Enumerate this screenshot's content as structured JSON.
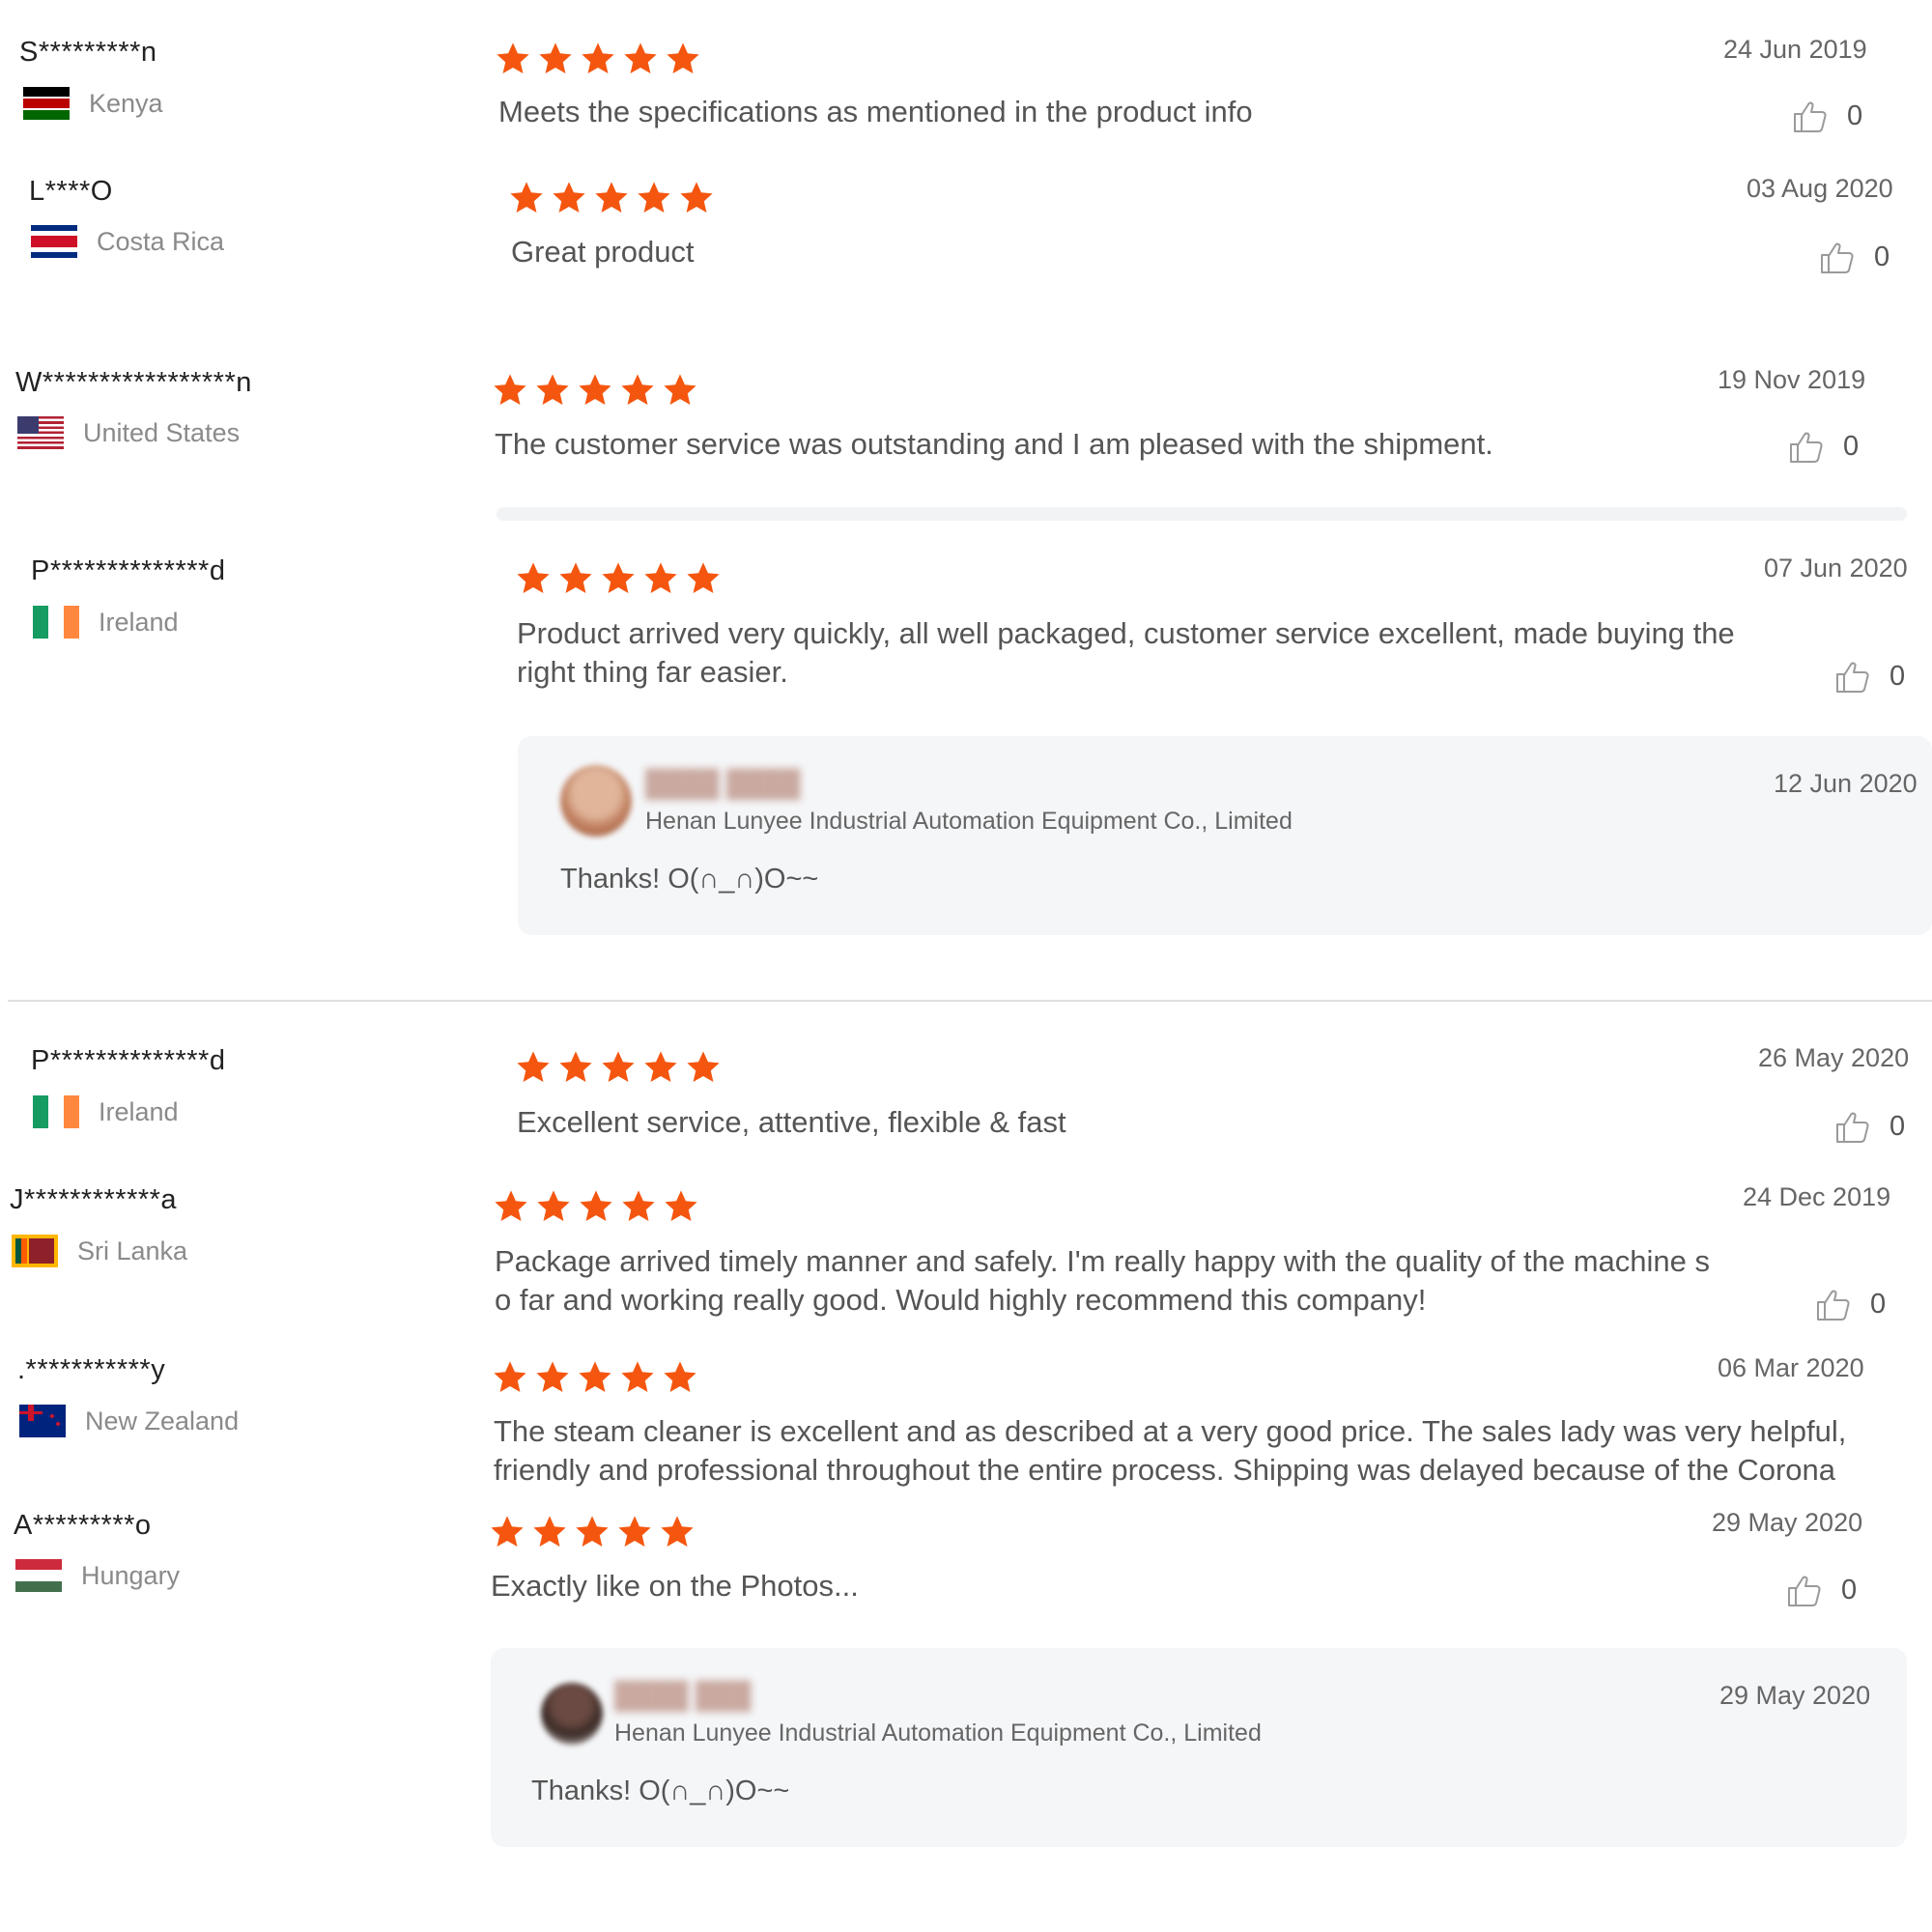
{
  "colors": {
    "star": "#f5560f",
    "text": "#555555",
    "muted": "#8a8a8a",
    "reply_bg": "#f5f6f8"
  },
  "icons": {
    "star": "star-icon",
    "like": "thumbs-up-icon"
  },
  "reviews": [
    {
      "name": "S*********n",
      "country": "Kenya",
      "flag": "kenya-flag-icon",
      "rating": 5,
      "date": "24 Jun 2019",
      "text": [
        "Meets the specifications as mentioned in the product info"
      ],
      "likes": "0"
    },
    {
      "name": "L****O",
      "country": "Costa Rica",
      "flag": "costa-rica-flag-icon",
      "rating": 5,
      "date": "03 Aug 2020",
      "text": [
        "Great product"
      ],
      "likes": "0"
    },
    {
      "name": "W*****************n",
      "country": "United States",
      "flag": "us-flag-icon",
      "rating": 5,
      "date": "19 Nov 2019",
      "text": [
        "The customer service was outstanding and I am pleased with the shipment."
      ],
      "likes": "0"
    },
    {
      "name": "P**************d",
      "country": "Ireland",
      "flag": "ireland-flag-icon",
      "rating": 5,
      "date": "07 Jun 2020",
      "text": [
        "Product arrived very quickly, all well packaged, customer service excellent, made buying the",
        "right thing far easier."
      ],
      "likes": "0",
      "reply": {
        "company": "Henan Lunyee Industrial Automation Equipment Co., Limited",
        "text": "Thanks! O(∩_∩)O~~",
        "date": "12 Jun 2020"
      }
    },
    {
      "name": "P**************d",
      "country": "Ireland",
      "flag": "ireland-flag-icon",
      "rating": 5,
      "date": "26 May 2020",
      "text": [
        "Excellent service, attentive, flexible & fast"
      ],
      "likes": "0"
    },
    {
      "name": "J************a",
      "country": "Sri Lanka",
      "flag": "sri-lanka-flag-icon",
      "rating": 5,
      "date": "24 Dec 2019",
      "text": [
        "Package arrived timely manner and safely. I'm really happy with the quality of the machine s",
        "o far and working really good. Would highly recommend this company!"
      ],
      "likes": "0"
    },
    {
      "name": ".***********y",
      "country": "New Zealand",
      "flag": "new-zealand-flag-icon",
      "rating": 5,
      "date": "06 Mar 2020",
      "text": [
        "The steam cleaner is excellent and as described at a very good price. The sales lady was very helpful,",
        "friendly and professional throughout the entire process. Shipping was delayed because of the Corona"
      ]
    },
    {
      "name": "A*********o",
      "country": "Hungary",
      "flag": "hungary-flag-icon",
      "rating": 5,
      "date": "29 May 2020",
      "text": [
        "Exactly like on the Photos..."
      ],
      "likes": "0",
      "reply": {
        "company": "Henan Lunyee Industrial Automation Equipment Co., Limited",
        "text": "Thanks! O(∩_∩)O~~",
        "date": "29 May 2020"
      }
    }
  ]
}
